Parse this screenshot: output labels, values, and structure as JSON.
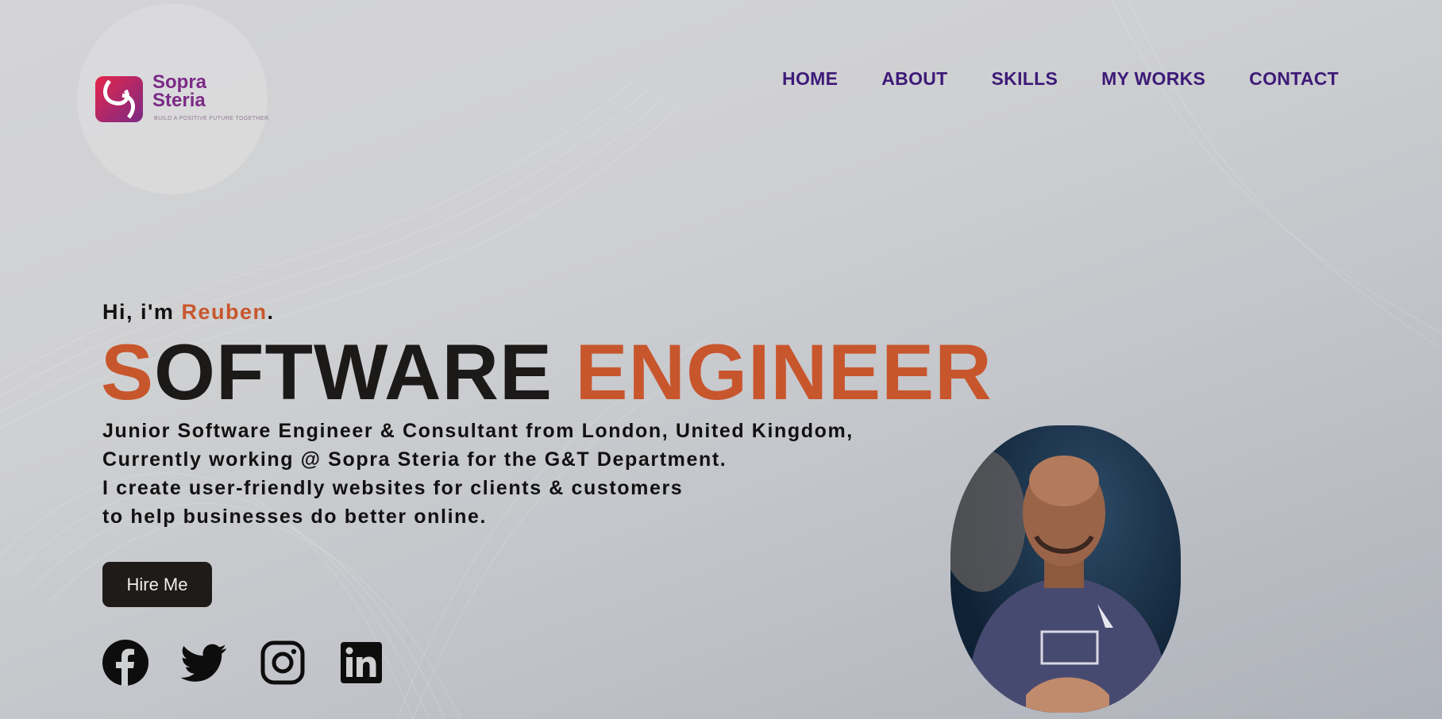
{
  "brand": {
    "name_line1": "Sopra",
    "name_line2": "Steria",
    "tagline": "BUILD A POSITIVE FUTURE TOGETHER",
    "colors": {
      "primary": "#7b2a86",
      "accent": "#e5264a"
    }
  },
  "nav": {
    "items": [
      {
        "label": "HOME"
      },
      {
        "label": "ABOUT"
      },
      {
        "label": "SKILLS"
      },
      {
        "label": "MY WORKS"
      },
      {
        "label": "CONTACT"
      }
    ],
    "color": "#3d1a78"
  },
  "hero": {
    "greeting_prefix": "Hi, i'm ",
    "greeting_name": "Reuben",
    "greeting_suffix": ".",
    "headline_first_letter": "S",
    "headline_rest": "OFTWARE ",
    "headline_accent": "ENGINEER",
    "intro_lines": [
      "Junior Software Engineer & Consultant from London, United Kingdom,",
      "Currently working @ Sopra Steria for the G&T Department.",
      "I create user-friendly websites for clients & customers",
      "to help businesses do better online."
    ],
    "cta_label": "Hire Me",
    "accent_color": "#c8562d"
  },
  "socials": [
    {
      "icon": "facebook-icon"
    },
    {
      "icon": "twitter-icon"
    },
    {
      "icon": "instagram-icon"
    },
    {
      "icon": "linkedin-icon"
    }
  ]
}
